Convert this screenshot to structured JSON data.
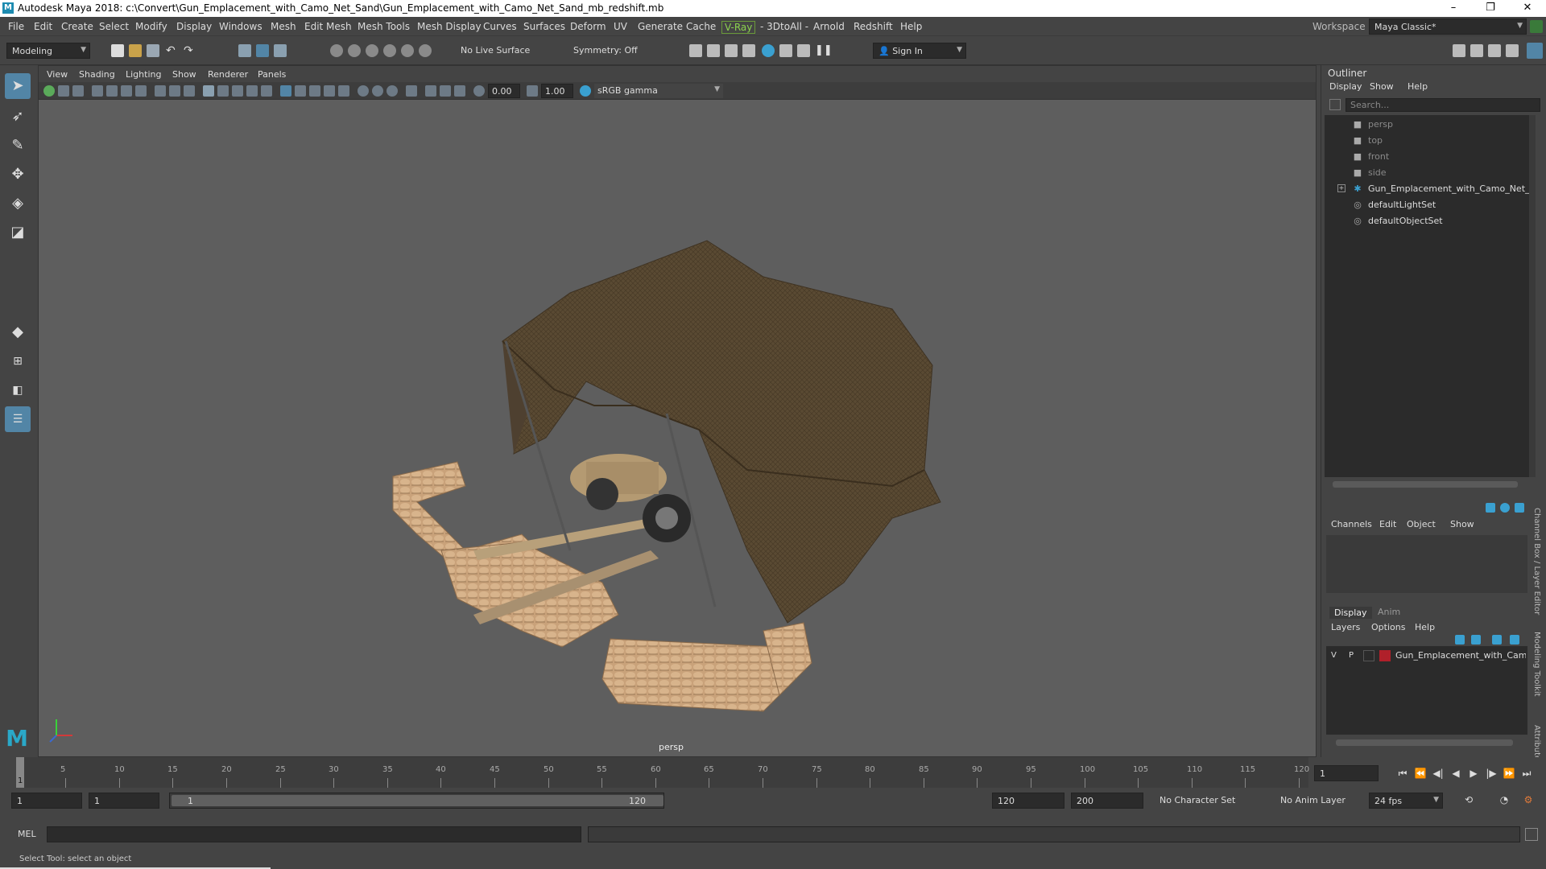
{
  "window": {
    "title": "Autodesk Maya 2018: c:\\Convert\\Gun_Emplacement_with_Camo_Net_Sand\\Gun_Emplacement_with_Camo_Net_Sand_mb_redshift.mb",
    "min": "–",
    "max": "❐",
    "close": "✕"
  },
  "menu": {
    "items": [
      "File",
      "Edit",
      "Create",
      "Select",
      "Modify",
      "Display",
      "Windows",
      "Mesh",
      "Edit Mesh",
      "Mesh Tools",
      "Mesh Display",
      "Curves",
      "Surfaces",
      "Deform",
      "UV",
      "Generate",
      "Cache",
      "V-Ray",
      "- 3DtoAll -",
      "Arnold",
      "Redshift",
      "Help"
    ],
    "workspace_label": "Workspace :",
    "workspace_value": "Maya Classic*"
  },
  "shelf": {
    "mode": "Modeling",
    "live_surface": "No Live Surface",
    "symmetry": "Symmetry: Off",
    "sign_in": "Sign In"
  },
  "viewport": {
    "menus": [
      "View",
      "Shading",
      "Lighting",
      "Show",
      "Renderer",
      "Panels"
    ],
    "exposure": "0.00",
    "gamma": "1.00",
    "color_space": "sRGB gamma",
    "camera_label": "persp"
  },
  "outliner": {
    "title": "Outliner",
    "menus": [
      "Display",
      "Show",
      "Help"
    ],
    "search_placeholder": "Search...",
    "items": [
      {
        "label": "persp",
        "icon": "camera-icon",
        "dim": true
      },
      {
        "label": "top",
        "icon": "camera-icon",
        "dim": true
      },
      {
        "label": "front",
        "icon": "camera-icon",
        "dim": true
      },
      {
        "label": "side",
        "icon": "camera-icon",
        "dim": true
      },
      {
        "label": "Gun_Emplacement_with_Camo_Net_Sand",
        "icon": "group-icon",
        "dim": false
      },
      {
        "label": "defaultLightSet",
        "icon": "set-icon",
        "dim": false
      },
      {
        "label": "defaultObjectSet",
        "icon": "set-icon",
        "dim": false
      }
    ]
  },
  "channelbox": {
    "menus": [
      "Channels",
      "Edit",
      "Object",
      "Show"
    ],
    "tabs": [
      "Display",
      "Anim"
    ],
    "layer_menus": [
      "Layers",
      "Options",
      "Help"
    ],
    "layer": {
      "v": "V",
      "p": "P",
      "name": "Gun_Emplacement_with_Camo",
      "color": "#b0202a"
    },
    "side_tabs": [
      "Channel Box / Layer Editor",
      "Modeling Toolkit",
      "Attribute Editor"
    ]
  },
  "timeline": {
    "ticks": [
      "5",
      "10",
      "15",
      "20",
      "25",
      "30",
      "35",
      "40",
      "45",
      "50",
      "55",
      "60",
      "65",
      "70",
      "75",
      "80",
      "85",
      "90",
      "95",
      "100",
      "105",
      "110",
      "115",
      "120"
    ],
    "current_marker": "1",
    "current_frame": "1"
  },
  "range": {
    "start": "1",
    "anim_start": "1",
    "slider_start": "1",
    "slider_end": "120",
    "end": "120",
    "anim_end": "200",
    "character_set": "No Character Set",
    "anim_layer": "No Anim Layer",
    "fps": "24 fps"
  },
  "command": {
    "label": "MEL"
  },
  "help": {
    "text": "Select Tool: select an object"
  }
}
